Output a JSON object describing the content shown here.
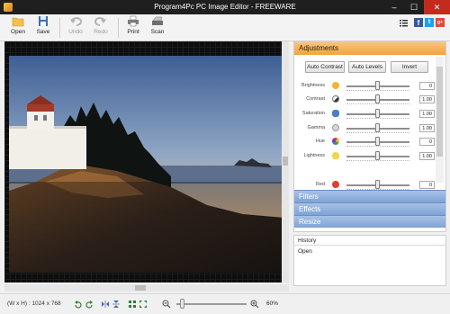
{
  "window": {
    "title": "Program4Pc PC Image Editor - FREEWARE",
    "controls": {
      "minimize": "–",
      "maximize": "☐",
      "close": "✕"
    }
  },
  "toolbar": {
    "buttons": [
      {
        "label": "Open",
        "icon": "folder-icon",
        "enabled": true
      },
      {
        "label": "Save",
        "icon": "save-icon",
        "enabled": true
      },
      {
        "label": "Undo",
        "icon": "undo-icon",
        "enabled": false
      },
      {
        "label": "Redo",
        "icon": "redo-icon",
        "enabled": false
      },
      {
        "label": "Print",
        "icon": "printer-icon",
        "enabled": true
      },
      {
        "label": "Scan",
        "icon": "scanner-icon",
        "enabled": true
      }
    ],
    "right_icons": [
      "list-icon",
      "facebook-icon",
      "twitter-icon",
      "googleplus-icon"
    ],
    "social_letters": {
      "facebook": "f",
      "twitter": "t",
      "googleplus": "g+"
    }
  },
  "panel": {
    "sections": {
      "adjustments": "Adjustments",
      "filters": "Filters",
      "effects": "Effects",
      "resize": "Resize"
    },
    "buttons": {
      "auto_contrast": "Auto Contrast",
      "auto_levels": "Auto Levels",
      "invert": "Invert"
    },
    "adjustments": [
      {
        "label": "Brightness",
        "value": "0",
        "icon": "sun-icon",
        "level": 0.5
      },
      {
        "label": "Contrast",
        "value": "1.00",
        "icon": "contrast-icon",
        "level": 0.5
      },
      {
        "label": "Saturation",
        "value": "1.00",
        "icon": "saturation-icon",
        "level": 0.5
      },
      {
        "label": "Gamma",
        "value": "1.00",
        "icon": "gamma-icon",
        "level": 0.5
      },
      {
        "label": "Hue",
        "value": "0",
        "icon": "hue-wheel-icon",
        "level": 0.5
      },
      {
        "label": "Lightness",
        "value": "1.00",
        "icon": "bulb-icon",
        "level": 0.5
      },
      {
        "label": "Red",
        "value": "0",
        "icon": "red-channel-icon",
        "level": 0.5
      }
    ]
  },
  "history": {
    "title": "History",
    "items": [
      "Open"
    ]
  },
  "status": {
    "dimensions": "(W x H) : 1024 x 768",
    "zoom": "60%",
    "zoom_level": 0.6
  },
  "colors": {
    "accent_orange": "#f3a33c",
    "section_blue": "#7ea3d6",
    "titlebar": "#1f1f1f",
    "close_red": "#c42b1c"
  }
}
